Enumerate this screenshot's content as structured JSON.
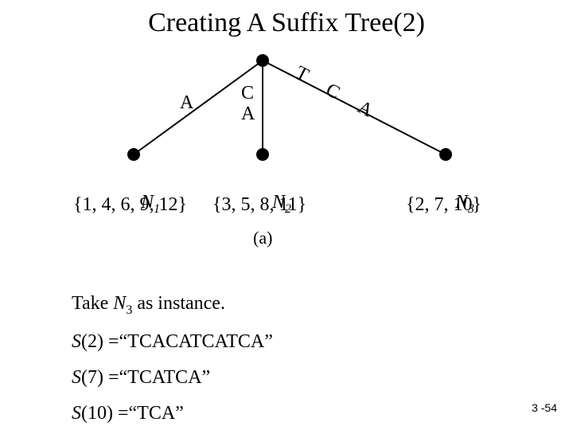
{
  "title": "Creating A Suffix Tree(2)",
  "diagram": {
    "edges": {
      "left": "A",
      "mid_line1": "C",
      "mid_line2": "A",
      "right_c1": "T",
      "right_c2": "C",
      "right_c3": "A"
    },
    "leaves": {
      "n1_name": "N",
      "n1_sub": "1",
      "n1_set": "{1, 4, 6, 9, 12}",
      "n2_name": "N",
      "n2_sub": "2",
      "n2_set": "{3, 5, 8, 11}",
      "n3_name": "N",
      "n3_sub": "3",
      "n3_set": "{2, 7, 10}"
    },
    "fig": "(a)"
  },
  "take_line": {
    "prefix": "Take ",
    "N": "N",
    "sub": "3",
    "suffix": " as instance."
  },
  "s2": {
    "S": "S",
    "arg": "(2)   =",
    "val": "“TCACATCATCA”"
  },
  "s7": {
    "S": "S",
    "arg": "(7)   =",
    "val": "“TCATCA”"
  },
  "s10": {
    "S": "S",
    "arg": "(10) =",
    "val": "“TCA”"
  },
  "page_num": "3 -54"
}
